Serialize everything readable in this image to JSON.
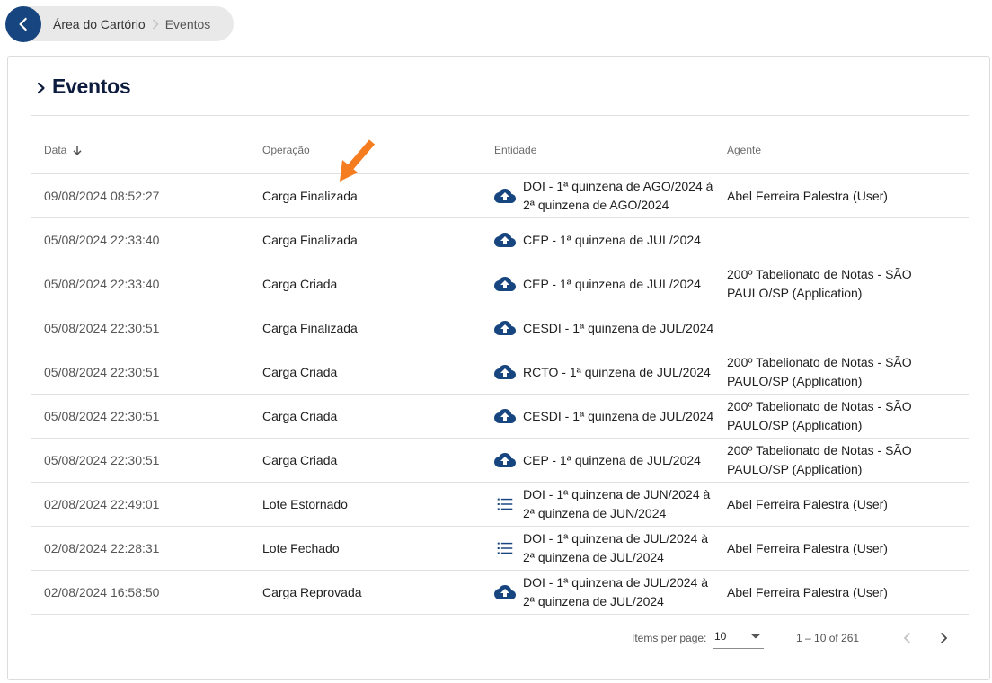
{
  "breadcrumb": {
    "items": [
      "Área do Cartório",
      "Eventos"
    ]
  },
  "page": {
    "title": "Eventos"
  },
  "table": {
    "headers": {
      "date": "Data",
      "operation": "Operação",
      "entity": "Entidade",
      "agent": "Agente"
    },
    "sort": {
      "column": "Data",
      "direction": "desc"
    },
    "rows": [
      {
        "date": "09/08/2024 08:52:27",
        "operation": "Carga Finalizada",
        "entity_icon": "cloud-upload-icon",
        "entity": "DOI - 1ª quinzena de AGO/2024 à 2ª quinzena de AGO/2024",
        "agent": "Abel Ferreira Palestra (User)"
      },
      {
        "date": "05/08/2024 22:33:40",
        "operation": "Carga Finalizada",
        "entity_icon": "cloud-upload-icon",
        "entity": "CEP - 1ª quinzena de JUL/2024",
        "agent": ""
      },
      {
        "date": "05/08/2024 22:33:40",
        "operation": "Carga Criada",
        "entity_icon": "cloud-upload-icon",
        "entity": "CEP - 1ª quinzena de JUL/2024",
        "agent": "200º Tabelionato de Notas - SÃO PAULO/SP (Application)"
      },
      {
        "date": "05/08/2024 22:30:51",
        "operation": "Carga Finalizada",
        "entity_icon": "cloud-upload-icon",
        "entity": "CESDI - 1ª quinzena de JUL/2024",
        "agent": ""
      },
      {
        "date": "05/08/2024 22:30:51",
        "operation": "Carga Criada",
        "entity_icon": "cloud-upload-icon",
        "entity": "RCTO - 1ª quinzena de JUL/2024",
        "agent": "200º Tabelionato de Notas - SÃO PAULO/SP (Application)"
      },
      {
        "date": "05/08/2024 22:30:51",
        "operation": "Carga Criada",
        "entity_icon": "cloud-upload-icon",
        "entity": "CESDI - 1ª quinzena de JUL/2024",
        "agent": "200º Tabelionato de Notas - SÃO PAULO/SP (Application)"
      },
      {
        "date": "05/08/2024 22:30:51",
        "operation": "Carga Criada",
        "entity_icon": "cloud-upload-icon",
        "entity": "CEP - 1ª quinzena de JUL/2024",
        "agent": "200º Tabelionato de Notas - SÃO PAULO/SP (Application)"
      },
      {
        "date": "02/08/2024 22:49:01",
        "operation": "Lote Estornado",
        "entity_icon": "list-icon",
        "entity": "DOI - 1ª quinzena de JUN/2024 à 2ª quinzena de JUN/2024",
        "agent": "Abel Ferreira Palestra (User)"
      },
      {
        "date": "02/08/2024 22:28:31",
        "operation": "Lote Fechado",
        "entity_icon": "list-icon",
        "entity": "DOI - 1ª quinzena de JUL/2024 à 2ª quinzena de JUL/2024",
        "agent": "Abel Ferreira Palestra (User)"
      },
      {
        "date": "02/08/2024 16:58:50",
        "operation": "Carga Reprovada",
        "entity_icon": "cloud-upload-icon",
        "entity": "DOI - 1ª quinzena de JUL/2024 à 2ª quinzena de JUL/2024",
        "agent": "Abel Ferreira Palestra (User)"
      }
    ]
  },
  "paginator": {
    "items_per_page_label": "Items per page:",
    "items_per_page_value": "10",
    "range_label": "1 – 10 of 261"
  },
  "colors": {
    "primary": "#17457f",
    "title": "#0d1b3e",
    "annotation_arrow": "#f57c1f",
    "breadcrumb_bg": "#e9e9e9"
  }
}
